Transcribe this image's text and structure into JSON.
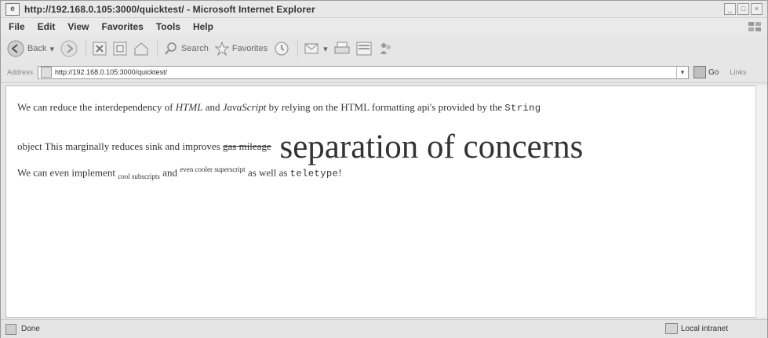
{
  "window": {
    "title": "http://192.168.0.105:3000/quicktest/ - Microsoft Internet Explorer"
  },
  "menu": {
    "items": [
      "File",
      "Edit",
      "View",
      "Favorites",
      "Tools",
      "Help"
    ]
  },
  "toolbar": {
    "back_label": "Back",
    "search_label": "Search",
    "favorites_label": "Favorites"
  },
  "address": {
    "label": "Address",
    "url": "http://192.168.0.105:3000/quicktest/",
    "go_label": "Go",
    "links_label": "Links"
  },
  "content": {
    "line1": {
      "t1": "We can reduce the interdependency of ",
      "em1": "HTML",
      "t2": " and ",
      "em2": "JavaScript",
      "t3": " by relying on the HTML formatting api's provided by the ",
      "code": "String"
    },
    "line2": {
      "t1": "object This marginally reduces sink and improves ",
      "strike": "gas mileage",
      "big": " separation of concerns"
    },
    "line3": {
      "t1": "We can even implement ",
      "sub": "cool subscripts",
      "t2": " and ",
      "sup": "even cooler superscript",
      "t3": " as well as ",
      "code": "teletype",
      "t4": "!"
    }
  },
  "status": {
    "text": "Done",
    "zone": "Local intranet"
  },
  "icons": {
    "browser": "ie-icon",
    "back": "back-arrow-icon",
    "forward": "forward-arrow-icon",
    "stop": "stop-icon",
    "refresh": "refresh-icon",
    "home": "home-icon",
    "search": "search-icon",
    "favorites": "star-icon",
    "history": "history-icon",
    "mail": "mail-icon",
    "print": "print-icon",
    "edit": "edit-icon",
    "messenger": "messenger-icon",
    "go": "go-arrow-icon",
    "zone": "intranet-icon"
  }
}
